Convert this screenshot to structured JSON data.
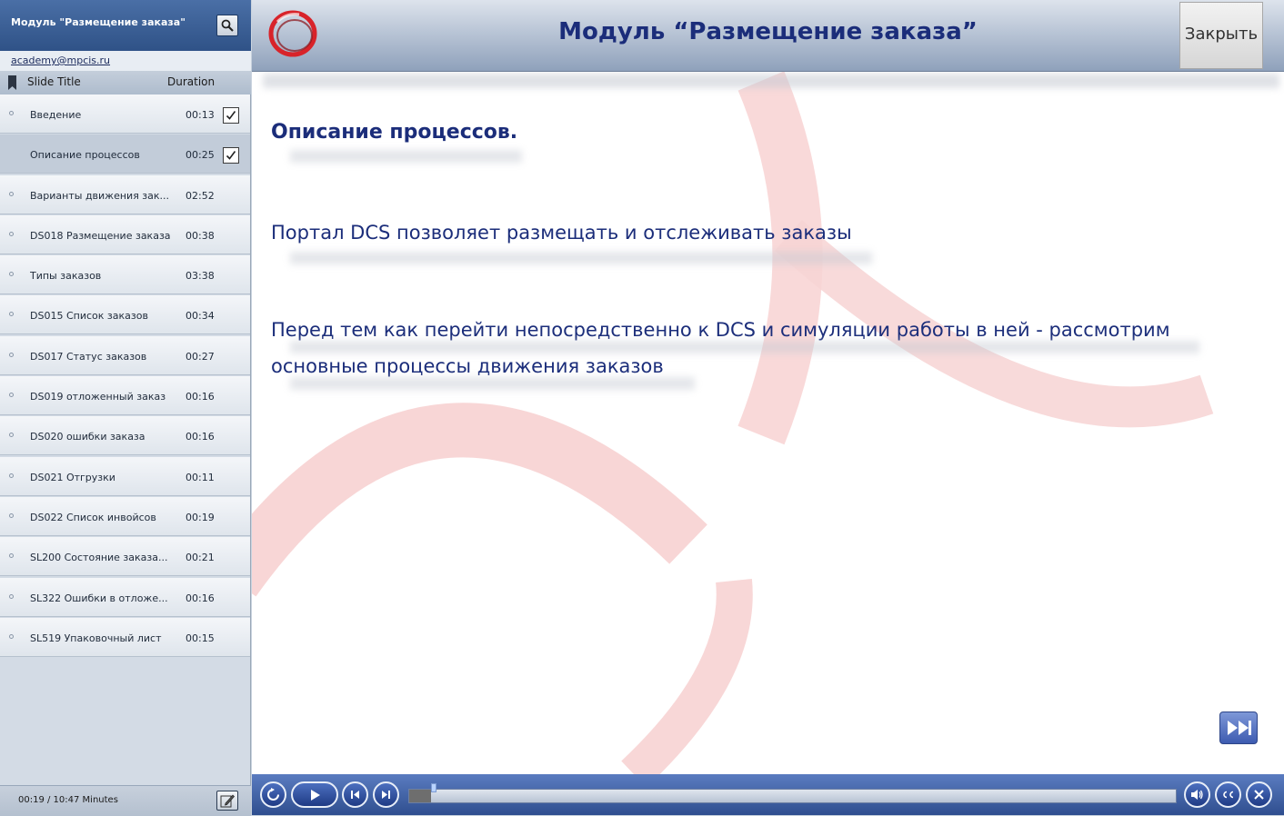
{
  "sidebar": {
    "title": "Модуль \"Размещение заказа\"",
    "email": "academy@mpcis.ru",
    "columns": {
      "title": "Slide Title",
      "duration": "Duration"
    },
    "slides": [
      {
        "title": "Введение",
        "duration": "00:13",
        "checked": true
      },
      {
        "title": "Описание процессов",
        "duration": "00:25",
        "checked": true,
        "active": true
      },
      {
        "title": "Варианты движения зак...",
        "duration": "02:52"
      },
      {
        "title": "DS018 Размещение заказа",
        "duration": "00:38"
      },
      {
        "title": "Типы заказов",
        "duration": "03:38"
      },
      {
        "title": "DS015 Список заказов",
        "duration": "00:34"
      },
      {
        "title": "DS017 Статус заказов",
        "duration": "00:27"
      },
      {
        "title": "DS019 отложенный заказ",
        "duration": "00:16"
      },
      {
        "title": "DS020 ошибки заказа",
        "duration": "00:16"
      },
      {
        "title": "DS021 Отгрузки",
        "duration": "00:11"
      },
      {
        "title": "DS022 Список инвойсов",
        "duration": "00:19"
      },
      {
        "title": "SL200 Состояние заказа...",
        "duration": "00:21"
      },
      {
        "title": "SL322 Ошибки в отложе...",
        "duration": "00:16"
      },
      {
        "title": "SL519 Упаковочный лист",
        "duration": "00:15"
      }
    ],
    "time": "00:19 / 10:47 Minutes"
  },
  "header": {
    "title": "Модуль “Размещение заказа”",
    "close_label": "Закрыть"
  },
  "slide": {
    "heading": "Описание процессов.",
    "line1": "Портал DCS позволяет размещать и отслеживать заказы",
    "line2": "Перед тем как перейти непосредственно к DCS и симуляции работы в ней - рассмотрим основные процессы движения заказов"
  },
  "player": {
    "progress": 0.029
  },
  "icons": {
    "search": "search-icon",
    "bookmark": "bookmark-icon",
    "check": "check-icon",
    "notes": "pencil-icon",
    "next_slide": "fast-forward-icon",
    "rewind": "replay-icon",
    "play": "play-icon",
    "prev": "previous-icon",
    "next": "next-icon",
    "volume": "volume-icon",
    "cc": "cc-icon",
    "exit": "close-icon"
  },
  "colors": {
    "accent_blue": "#1b2d7a",
    "logo_red": "#d8232a",
    "arc_pink": "#f6c9c9"
  }
}
